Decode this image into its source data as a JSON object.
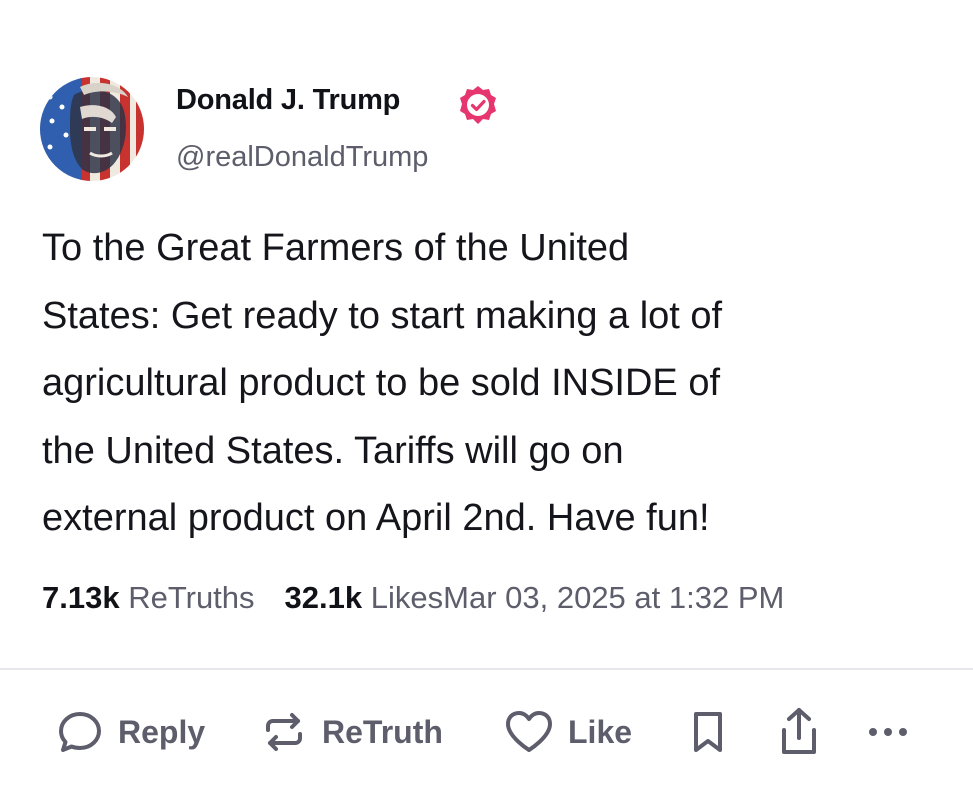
{
  "post": {
    "author": {
      "name": "Donald J. Trump",
      "handle": "@realDonaldTrump",
      "verified": true,
      "verified_color": "#e6356f"
    },
    "body_lines": [
      "To the Great Farmers of the United",
      "States: Get ready to start making a lot of",
      "agricultural product to be sold INSIDE of",
      "the United States. Tariffs will go on",
      "external product on April 2nd. Have fun!"
    ],
    "stats": {
      "retruths_count": "7.13k",
      "retruths_label": "ReTruths",
      "likes_count": "32.1k",
      "likes_label": "Likes",
      "timestamp": "Mar 03, 2025 at 1:32 PM"
    },
    "actions": {
      "reply_label": "Reply",
      "retruth_label": "ReTruth",
      "like_label": "Like"
    },
    "icons": {
      "reply": "speech-bubble-icon",
      "retruth": "repost-arrows-icon",
      "like": "heart-icon",
      "bookmark": "bookmark-icon",
      "share": "share-upload-icon",
      "more": "more-dots-icon",
      "verified": "verified-badge-icon"
    }
  }
}
